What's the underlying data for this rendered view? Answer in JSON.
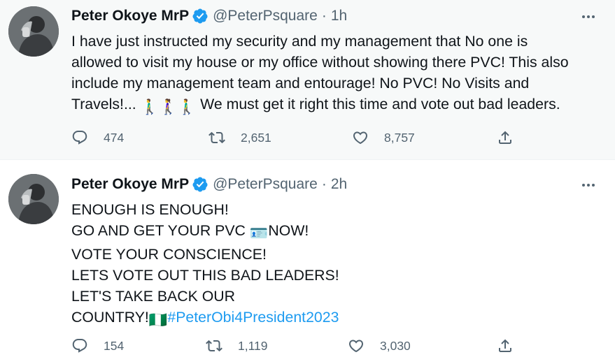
{
  "tweets": [
    {
      "author_name": "Peter Okoye MrP",
      "handle": "@PeterPsquare",
      "separator": "·",
      "time": "1h",
      "lines": [
        "I have just instructed my security and my management that No one is",
        "allowed to visit my house or my office without showing there PVC! This also",
        "include my management team and entourage! No PVC! No Visits and"
      ],
      "last_line_prefix": "Travels!... ",
      "last_line_emoji": "🚶‍♂️🚶‍♀️🚶‍♂️",
      "last_line_suffix": " We must get it right this time and vote out bad leaders.",
      "reply_count": "474",
      "retweet_count": "2,651",
      "like_count": "8,757"
    },
    {
      "author_name": "Peter Okoye MrP",
      "handle": "@PeterPsquare",
      "separator": "·",
      "time": "2h",
      "line1": "ENOUGH IS ENOUGH!",
      "line2_prefix": "GO AND GET YOUR PVC ",
      "line2_emoji": "🪪",
      "line2_suffix": "NOW!",
      "line3": "VOTE YOUR CONSCIENCE!",
      "line4": "LETS VOTE OUT THIS BAD LEADERS!",
      "line5": "LET'S TAKE BACK OUR",
      "line6_prefix": "COUNTRY!",
      "line6_emoji": "🇳🇬",
      "hashtag": "#PeterObi4President2023",
      "reply_count": "154",
      "retweet_count": "1,119",
      "like_count": "3,030"
    }
  ],
  "colors": {
    "text": "#0f1419",
    "secondary": "#536471",
    "link": "#1d9bf0",
    "verified": "#1d9bf0",
    "highlight_bg": "#f7f9f9"
  },
  "icons": {
    "verified": "verified-badge-icon",
    "more": "more-dots-icon",
    "reply": "reply-bubble-icon",
    "retweet": "retweet-icon",
    "like": "heart-icon",
    "share": "share-upload-icon"
  }
}
